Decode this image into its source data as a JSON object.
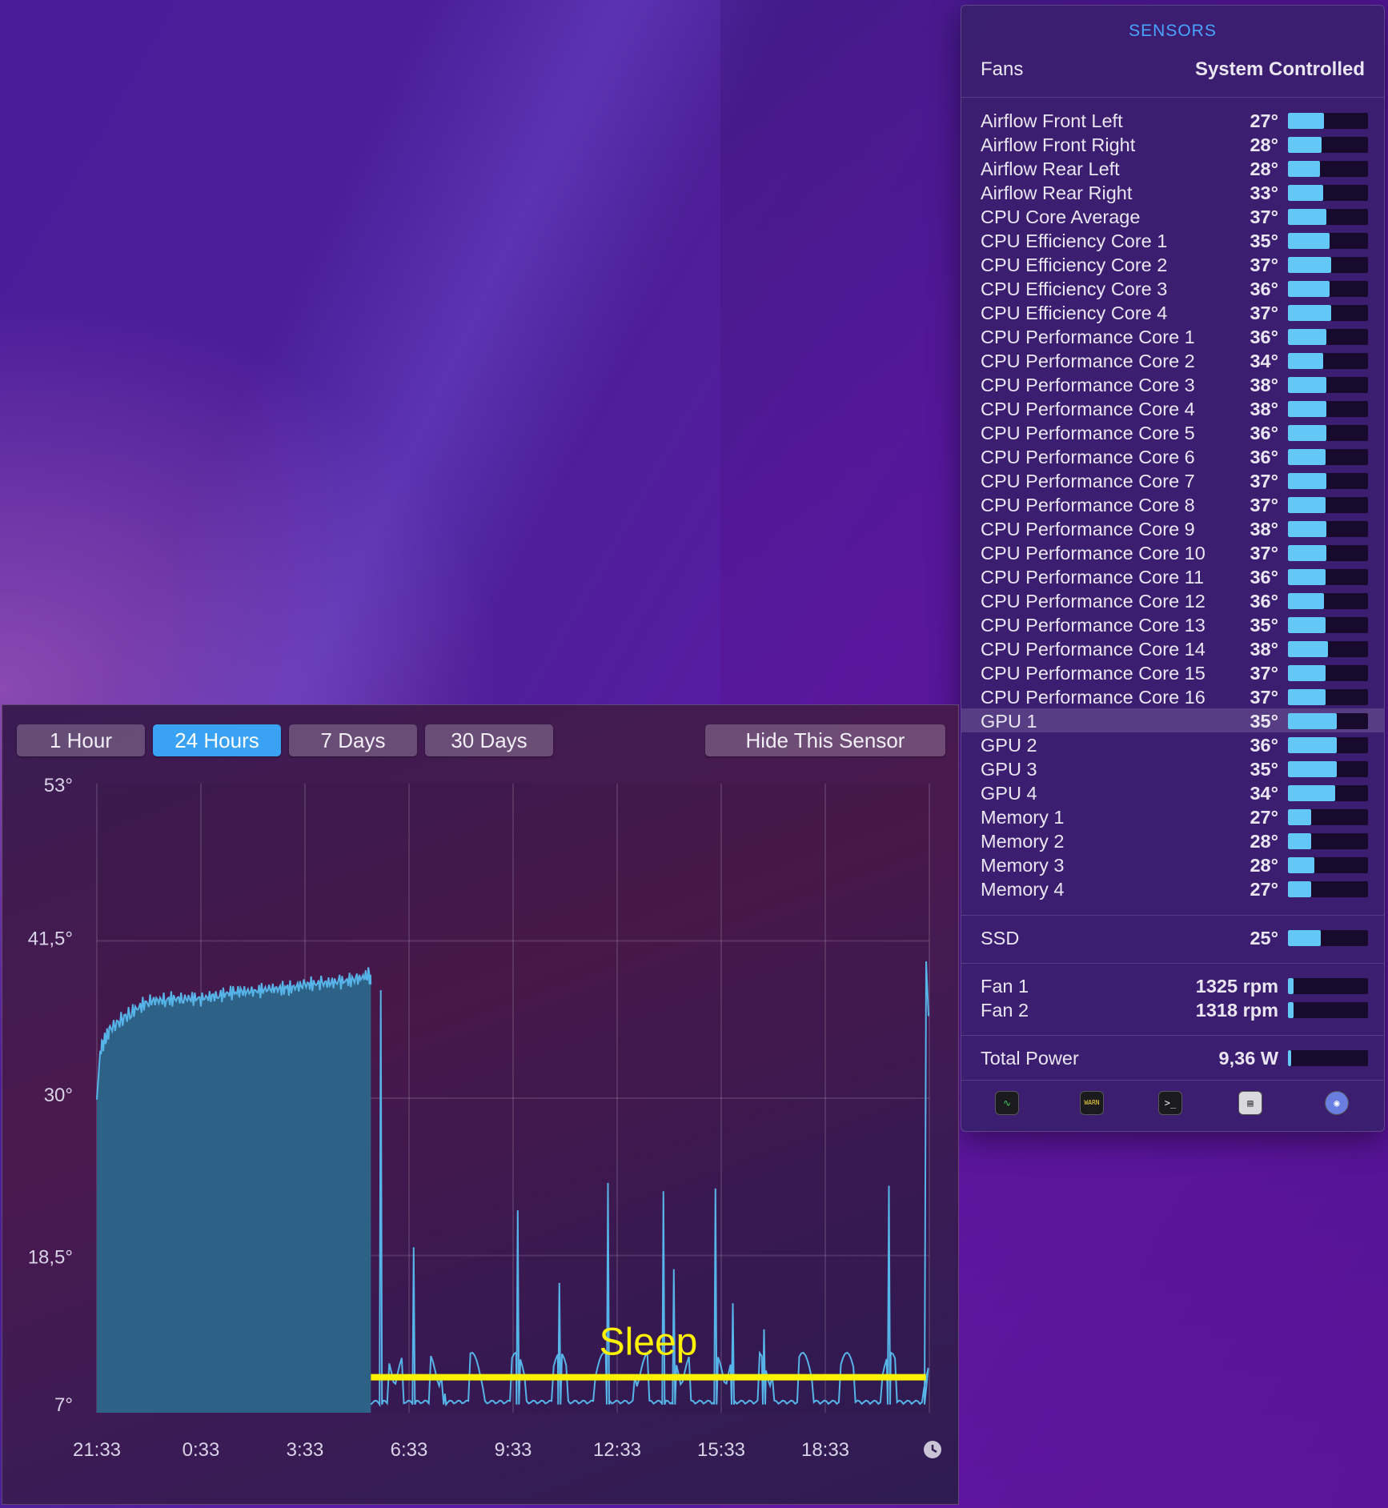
{
  "sensors_panel": {
    "title": "SENSORS",
    "fans_label": "Fans",
    "fans_mode": "System Controlled",
    "groups": [
      [
        {
          "name": "Airflow Front Left",
          "value": "27°",
          "level": 0.45
        },
        {
          "name": "Airflow Front Right",
          "value": "28°",
          "level": 0.42
        },
        {
          "name": "Airflow Rear Left",
          "value": "28°",
          "level": 0.4
        },
        {
          "name": "Airflow Rear Right",
          "value": "33°",
          "level": 0.44
        },
        {
          "name": "CPU Core Average",
          "value": "37°",
          "level": 0.48
        },
        {
          "name": "CPU Efficiency Core 1",
          "value": "35°",
          "level": 0.52
        },
        {
          "name": "CPU Efficiency Core 2",
          "value": "37°",
          "level": 0.54
        },
        {
          "name": "CPU Efficiency Core 3",
          "value": "36°",
          "level": 0.52
        },
        {
          "name": "CPU Efficiency Core 4",
          "value": "37°",
          "level": 0.54
        },
        {
          "name": "CPU Performance Core 1",
          "value": "36°",
          "level": 0.48
        },
        {
          "name": "CPU Performance Core 2",
          "value": "34°",
          "level": 0.44
        },
        {
          "name": "CPU Performance Core 3",
          "value": "38°",
          "level": 0.48
        },
        {
          "name": "CPU Performance Core 4",
          "value": "38°",
          "level": 0.48
        },
        {
          "name": "CPU Performance Core 5",
          "value": "36°",
          "level": 0.48
        },
        {
          "name": "CPU Performance Core 6",
          "value": "36°",
          "level": 0.47
        },
        {
          "name": "CPU Performance Core 7",
          "value": "37°",
          "level": 0.48
        },
        {
          "name": "CPU Performance Core 8",
          "value": "37°",
          "level": 0.47
        },
        {
          "name": "CPU Performance Core 9",
          "value": "38°",
          "level": 0.48
        },
        {
          "name": "CPU Performance Core 10",
          "value": "37°",
          "level": 0.48
        },
        {
          "name": "CPU Performance Core 11",
          "value": "36°",
          "level": 0.47
        },
        {
          "name": "CPU Performance Core 12",
          "value": "36°",
          "level": 0.45
        },
        {
          "name": "CPU Performance Core 13",
          "value": "35°",
          "level": 0.47
        },
        {
          "name": "CPU Performance Core 14",
          "value": "38°",
          "level": 0.5
        },
        {
          "name": "CPU Performance Core 15",
          "value": "37°",
          "level": 0.47
        },
        {
          "name": "CPU Performance Core 16",
          "value": "37°",
          "level": 0.47
        },
        {
          "name": "GPU 1",
          "value": "35°",
          "level": 0.61,
          "selected": true
        },
        {
          "name": "GPU 2",
          "value": "36°",
          "level": 0.61
        },
        {
          "name": "GPU 3",
          "value": "35°",
          "level": 0.61
        },
        {
          "name": "GPU 4",
          "value": "34°",
          "level": 0.59
        },
        {
          "name": "Memory 1",
          "value": "27°",
          "level": 0.29
        },
        {
          "name": "Memory 2",
          "value": "28°",
          "level": 0.29
        },
        {
          "name": "Memory 3",
          "value": "28°",
          "level": 0.33
        },
        {
          "name": "Memory 4",
          "value": "27°",
          "level": 0.29
        }
      ],
      [
        {
          "name": "SSD",
          "value": "25°",
          "level": 0.41
        }
      ],
      [
        {
          "name": "Fan 1",
          "value": "1325 rpm",
          "level": 0.07
        },
        {
          "name": "Fan 2",
          "value": "1318 rpm",
          "level": 0.07
        }
      ],
      [
        {
          "name": "Total Power",
          "value": "9,36 W",
          "level": 0.04
        }
      ]
    ],
    "toolbar": [
      {
        "name": "activity-monitor-icon",
        "glyph": "∿"
      },
      {
        "name": "console-icon",
        "glyph": "WARN"
      },
      {
        "name": "terminal-icon",
        "glyph": ">_"
      },
      {
        "name": "system-information-icon",
        "glyph": "▤"
      },
      {
        "name": "disk-utility-icon",
        "glyph": "◉"
      }
    ]
  },
  "graph_window": {
    "range_tabs": [
      {
        "label": "1 Hour",
        "active": false
      },
      {
        "label": "24 Hours",
        "active": true
      },
      {
        "label": "7 Days",
        "active": false
      },
      {
        "label": "30 Days",
        "active": false
      }
    ],
    "hide_button": "Hide This Sensor",
    "annotation": "Sleep",
    "colors": {
      "area": "#2e6186",
      "line": "#57b4e8",
      "sleep_line": "#fff200",
      "grid": "rgba(255,255,255,0.12)"
    }
  },
  "chart_data": {
    "type": "area",
    "y_ticks": [
      "53°",
      "41,5°",
      "30°",
      "18,5°",
      "7°"
    ],
    "ylim": [
      7,
      53
    ],
    "x_ticks": [
      "21:33",
      "0:33",
      "3:33",
      "6:33",
      "9:33",
      "12:33",
      "15:33",
      "18:33"
    ],
    "x_tick_hours": [
      0,
      3,
      6,
      9,
      12,
      15,
      18,
      21
    ],
    "xlim_hours": [
      0,
      24
    ],
    "grid": true,
    "active_series": [
      [
        0,
        29.9
      ],
      [
        0.1,
        33.6
      ],
      [
        0.4,
        35.1
      ],
      [
        1,
        36.3
      ],
      [
        1.5,
        37.1
      ],
      [
        2,
        37.2
      ],
      [
        2.5,
        37.3
      ],
      [
        3,
        37.3
      ],
      [
        3.5,
        37.5
      ],
      [
        4,
        37.8
      ],
      [
        4.5,
        37.8
      ],
      [
        5,
        38.0
      ],
      [
        5.5,
        38.0
      ],
      [
        6,
        38.3
      ],
      [
        6.5,
        38.4
      ],
      [
        7,
        38.5
      ],
      [
        7.5,
        38.7
      ],
      [
        7.85,
        39.0
      ],
      [
        7.9,
        38.4
      ]
    ],
    "sleep_spikes": [
      [
        8.15,
        37.9
      ],
      [
        9.1,
        19.1
      ],
      [
        10.0,
        8.4
      ],
      [
        12.1,
        21.8
      ],
      [
        13.3,
        16.5
      ],
      [
        14.7,
        23.8
      ],
      [
        16.3,
        23.2
      ],
      [
        16.6,
        17.5
      ],
      [
        17.8,
        23.4
      ],
      [
        18.3,
        15.0
      ],
      [
        19.2,
        13.1
      ],
      [
        22.8,
        23.6
      ],
      [
        24.0,
        40.0
      ]
    ],
    "sleep_annotation": {
      "label": "Sleep",
      "start_hours": 7.9,
      "end_hours": 23.9,
      "y": 9.6
    }
  }
}
